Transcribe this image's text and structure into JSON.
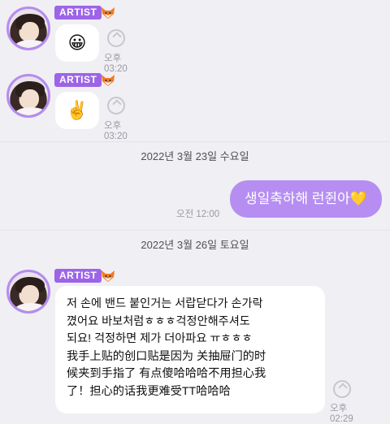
{
  "messages": [
    {
      "badge": "ARTIST",
      "emoji": "😀",
      "time": "오후 03:20"
    },
    {
      "badge": "ARTIST",
      "emoji": "✌️",
      "time": "오후 03:20"
    },
    {
      "badge": "ARTIST",
      "time": "오후 02:29",
      "lines": [
        "저 손에 밴드 붙인거는 서랍닫다가 손가락",
        "꼈어요 바보처럼ㅎㅎㅎ걱정안해주셔도",
        "되요! 걱정하면 제가 더아파요 ㅠㅎㅎㅎ",
        "我手上贴的创口贴是因为 关抽屉门的时",
        "候夹到手指了 有点傻哈哈哈不用担心我",
        "了！担心的话我更难受TT哈哈哈"
      ]
    }
  ],
  "dates": [
    "2022년 3월 23일 수요일",
    "2022년 3월 26일 토요일"
  ],
  "my_message": {
    "text": "생일축하해 런쥔아💛",
    "time": "오전 12:00"
  },
  "colors": {
    "accent": "#9d64e8",
    "my_bubble": "#b68ef2",
    "background": "#efeff4"
  },
  "icons": [
    "fox-emoji-icon",
    "translate-icon"
  ]
}
